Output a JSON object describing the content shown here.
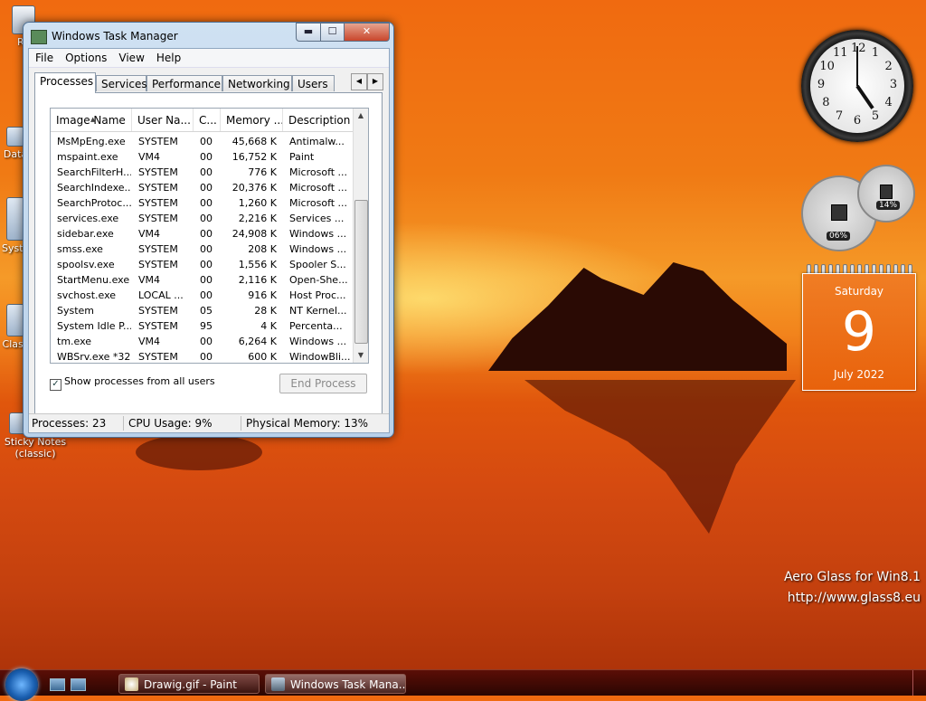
{
  "window": {
    "title": "Windows Task Manager",
    "controls": {
      "minimize": "▬",
      "maximize": "☐",
      "close": "✕"
    }
  },
  "menu": [
    "File",
    "Options",
    "View",
    "Help"
  ],
  "tabs": [
    "Processes",
    "Services",
    "Performance",
    "Networking",
    "Users"
  ],
  "active_tab": "Processes",
  "columns": [
    "Image Name",
    "User Na...",
    "C...",
    "Memory ...",
    "Description"
  ],
  "processes": [
    {
      "name": "MsMpEng.exe",
      "user": "SYSTEM",
      "cpu": "00",
      "memory": "45,668 K",
      "desc": "Antimalw..."
    },
    {
      "name": "mspaint.exe",
      "user": "VM4",
      "cpu": "00",
      "memory": "16,752 K",
      "desc": "Paint"
    },
    {
      "name": "SearchFilterH...",
      "user": "SYSTEM",
      "cpu": "00",
      "memory": "776 K",
      "desc": "Microsoft ..."
    },
    {
      "name": "SearchIndexe...",
      "user": "SYSTEM",
      "cpu": "00",
      "memory": "20,376 K",
      "desc": "Microsoft ..."
    },
    {
      "name": "SearchProtoc...",
      "user": "SYSTEM",
      "cpu": "00",
      "memory": "1,260 K",
      "desc": "Microsoft ..."
    },
    {
      "name": "services.exe",
      "user": "SYSTEM",
      "cpu": "00",
      "memory": "2,216 K",
      "desc": "Services ..."
    },
    {
      "name": "sidebar.exe",
      "user": "VM4",
      "cpu": "00",
      "memory": "24,908 K",
      "desc": "Windows ..."
    },
    {
      "name": "smss.exe",
      "user": "SYSTEM",
      "cpu": "00",
      "memory": "208 K",
      "desc": "Windows ..."
    },
    {
      "name": "spoolsv.exe",
      "user": "SYSTEM",
      "cpu": "00",
      "memory": "1,556 K",
      "desc": "Spooler S..."
    },
    {
      "name": "StartMenu.exe",
      "user": "VM4",
      "cpu": "00",
      "memory": "2,116 K",
      "desc": "Open-She..."
    },
    {
      "name": "svchost.exe",
      "user": "LOCAL ...",
      "cpu": "00",
      "memory": "916 K",
      "desc": "Host Proc..."
    },
    {
      "name": "System",
      "user": "SYSTEM",
      "cpu": "05",
      "memory": "28 K",
      "desc": "NT Kernel..."
    },
    {
      "name": "System Idle P...",
      "user": "SYSTEM",
      "cpu": "95",
      "memory": "4 K",
      "desc": "Percenta..."
    },
    {
      "name": "tm.exe",
      "user": "VM4",
      "cpu": "00",
      "memory": "6,264 K",
      "desc": "Windows ..."
    },
    {
      "name": "WBSrv.exe *32",
      "user": "SYSTEM",
      "cpu": "00",
      "memory": "600 K",
      "desc": "WindowBli..."
    }
  ],
  "show_all_users": {
    "label": "Show processes from all users",
    "checked": true
  },
  "end_process_label": "End Process",
  "status": {
    "processes": "Processes: 23",
    "cpu": "CPU Usage: 9%",
    "memory": "Physical Memory: 13%"
  },
  "desktop_icons": [
    {
      "label": "Re"
    },
    {
      "label": "Data"
    },
    {
      "label": "Syste"
    },
    {
      "label": "Class"
    },
    {
      "label": "Sticky Notes (classic)"
    }
  ],
  "clock": {
    "numbers": [
      "12",
      "1",
      "2",
      "3",
      "4",
      "5",
      "6",
      "7",
      "8",
      "9",
      "10",
      "11"
    ],
    "hour": 4.85,
    "minute": 0
  },
  "cpu_meter": {
    "cpu": "06%",
    "memory": "14%"
  },
  "calendar": {
    "weekday": "Saturday",
    "day": "9",
    "month_year": "July 2022"
  },
  "watermark": {
    "line1": "Aero Glass for Win8.1",
    "line2": "http://www.glass8.eu"
  },
  "taskbar": {
    "items": [
      {
        "label": "Drawig.gif - Paint",
        "active": false
      },
      {
        "label": "Windows Task Mana...",
        "active": true
      }
    ]
  }
}
